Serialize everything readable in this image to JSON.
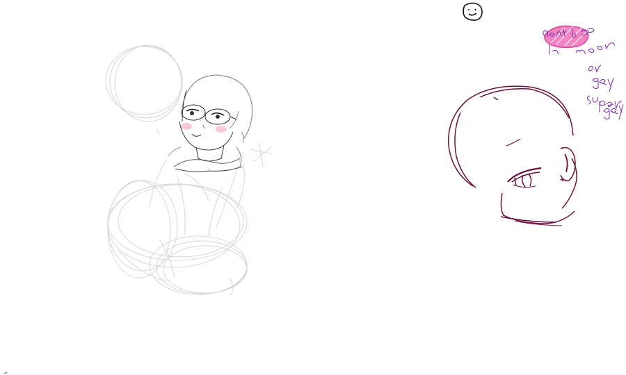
{
  "canvas": {
    "background": "#ffffff"
  },
  "colors": {
    "pencil_light": "#d6d6d6",
    "pencil_dark": "#2a2a2a",
    "blush": "#f2a9b6",
    "maroon": "#6b0f3a",
    "magenta": "#e0429a",
    "handwriting": "#7a2aa8",
    "doodle": "#111111"
  },
  "elements": {
    "smiley": {
      "icon": "smiley-doodle-icon"
    },
    "sketch_left": {
      "icon": "figure-with-glasses-sketch"
    },
    "sketch_right": {
      "icon": "maroon-head-sketch"
    },
    "scribble": {
      "icon": "pink-scribble"
    }
  }
}
